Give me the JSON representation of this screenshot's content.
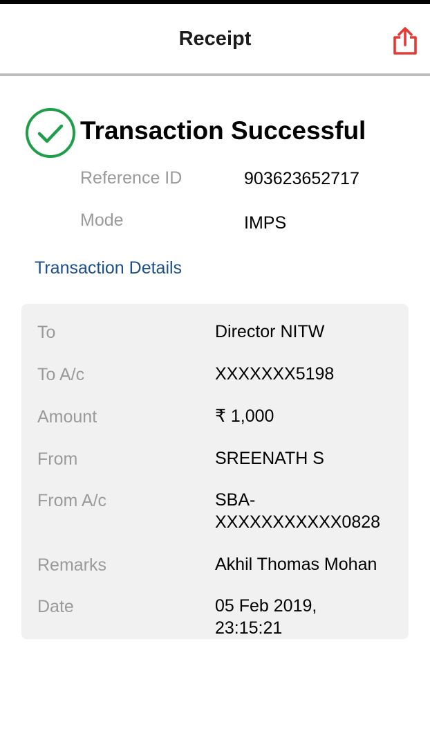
{
  "header": {
    "title": "Receipt",
    "share_icon": "share-icon",
    "accent_color": "#e53935"
  },
  "status": {
    "icon": "check-circle-icon",
    "color": "#1e9e4a",
    "title": "Transaction Successful"
  },
  "info": [
    {
      "label": "Reference ID",
      "value": "903623652717"
    },
    {
      "label": "Mode",
      "value": "IMPS"
    }
  ],
  "details": {
    "title": "Transaction Details",
    "title_color": "#1d4f8c",
    "rows": [
      {
        "label": "To",
        "value": "Director NITW"
      },
      {
        "label": "To A/c",
        "value": "XXXXXXX5198"
      },
      {
        "label": "Amount",
        "value": "₹ 1,000"
      },
      {
        "label": "From",
        "value": "SREENATH S"
      },
      {
        "label": "From A/c",
        "value": "SBA-\nXXXXXXXXXXX0828"
      },
      {
        "label": "Remarks",
        "value": "Akhil Thomas Mohan"
      },
      {
        "label": "Date",
        "value": "05 Feb 2019,\n23:15:21"
      }
    ]
  }
}
